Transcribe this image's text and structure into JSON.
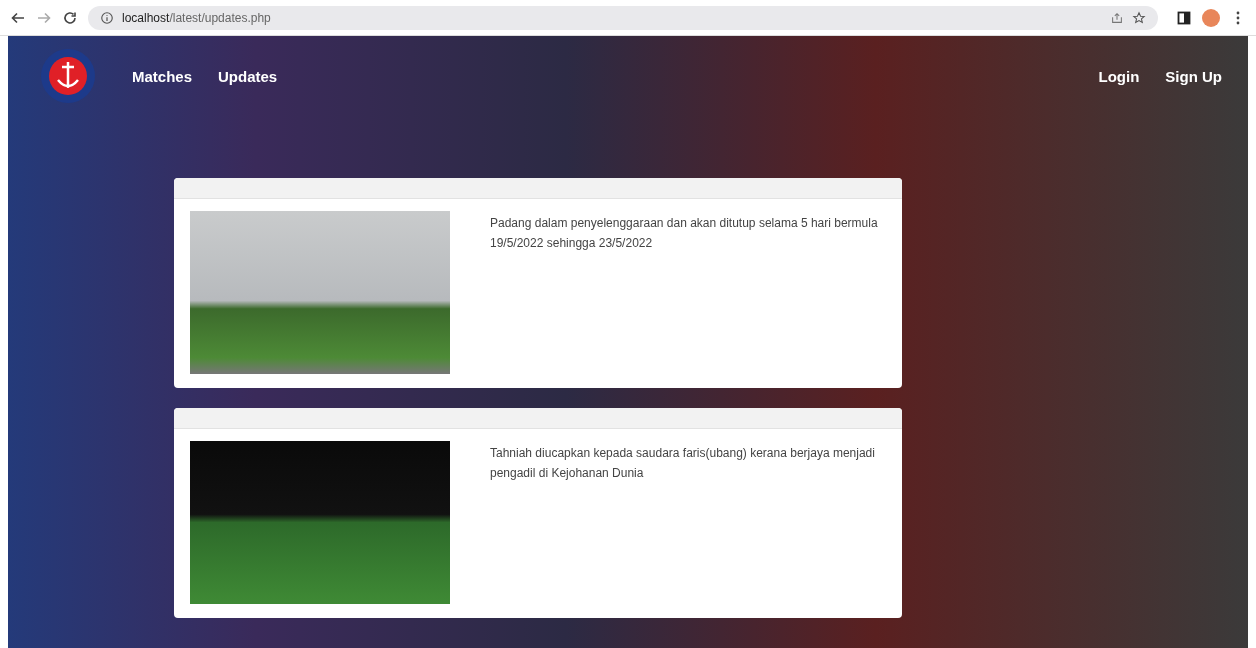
{
  "browser": {
    "url_host": "localhost",
    "url_path": "/latest/updates.php"
  },
  "nav": {
    "links": [
      {
        "label": "Matches"
      },
      {
        "label": "Updates"
      }
    ],
    "auth_links": [
      {
        "label": "Login"
      },
      {
        "label": "Sign Up"
      }
    ]
  },
  "updates": [
    {
      "kind": "field",
      "text": "Padang dalam penyelenggaraan dan akan ditutup selama 5 hari bermula 19/5/2022 sehingga 23/5/2022"
    },
    {
      "kind": "referees",
      "text": "Tahniah diucapkan kepada saudara faris(ubang) kerana berjaya menjadi pengadil di Kejohanan Dunia"
    }
  ]
}
